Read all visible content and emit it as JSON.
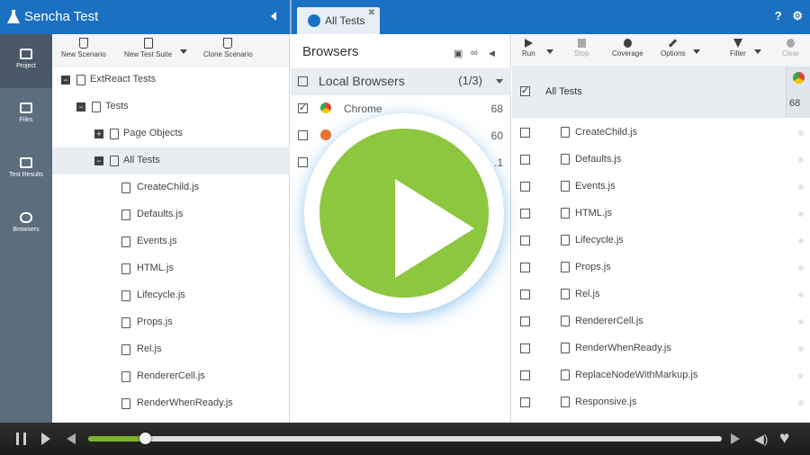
{
  "app": {
    "title": "Sencha Test"
  },
  "tab": {
    "label": "All Tests"
  },
  "topbar": {
    "help_label": "?",
    "settings_label": "⚙"
  },
  "rail": [
    {
      "label": "Project",
      "icon": "briefcase-icon"
    },
    {
      "label": "Files",
      "icon": "folder-icon"
    },
    {
      "label": "Test Results",
      "icon": "results-icon"
    },
    {
      "label": "Browsers",
      "icon": "cloud-icon"
    }
  ],
  "project_toolbar": {
    "new_scenario": "New Scenario",
    "new_test_suite": "New Test Suite",
    "clone_scenario": "Clone Scenario"
  },
  "tree": [
    {
      "label": "ExtReact Tests",
      "toggle": "−"
    },
    {
      "label": "Tests",
      "toggle": "−"
    },
    {
      "label": "Page Objects",
      "toggle": "+"
    },
    {
      "label": "All Tests",
      "toggle": "−"
    },
    {
      "label": "CreateChild.js"
    },
    {
      "label": "Defaults.js"
    },
    {
      "label": "Events.js"
    },
    {
      "label": "HTML.js"
    },
    {
      "label": "Lifecycle.js"
    },
    {
      "label": "Props.js"
    },
    {
      "label": "Rel.js"
    },
    {
      "label": "RendererCell.js"
    },
    {
      "label": "RenderWhenReady.js"
    }
  ],
  "browsers_panel": {
    "title": "Browsers",
    "group_label": "Local Browsers",
    "group_count": "(1/3)",
    "rows": [
      {
        "name": "Chrome",
        "version": "68",
        "checked": true
      },
      {
        "name": "",
        "version": "60",
        "checked": false
      },
      {
        "name": "",
        "version": ".1",
        "checked": false
      }
    ]
  },
  "tests_toolbar": {
    "run": "Run",
    "stop": "Stop",
    "coverage": "Coverage",
    "options": "Options",
    "filter": "Filter",
    "clear": "Clear"
  },
  "tests_panel": {
    "header": "All Tests",
    "browser_version": "68",
    "files": [
      "CreateChild.js",
      "Defaults.js",
      "Events.js",
      "HTML.js",
      "Lifecycle.js",
      "Props.js",
      "Rel.js",
      "RendererCell.js",
      "RenderWhenReady.js",
      "ReplaceNodeWithMarkup.js",
      "Responsive.js"
    ]
  },
  "player": {
    "progress_fraction": 0.09
  },
  "colors": {
    "brand_blue": "#1c70c2",
    "play_green": "#8dc63f",
    "progress_green": "#7ab22e"
  }
}
